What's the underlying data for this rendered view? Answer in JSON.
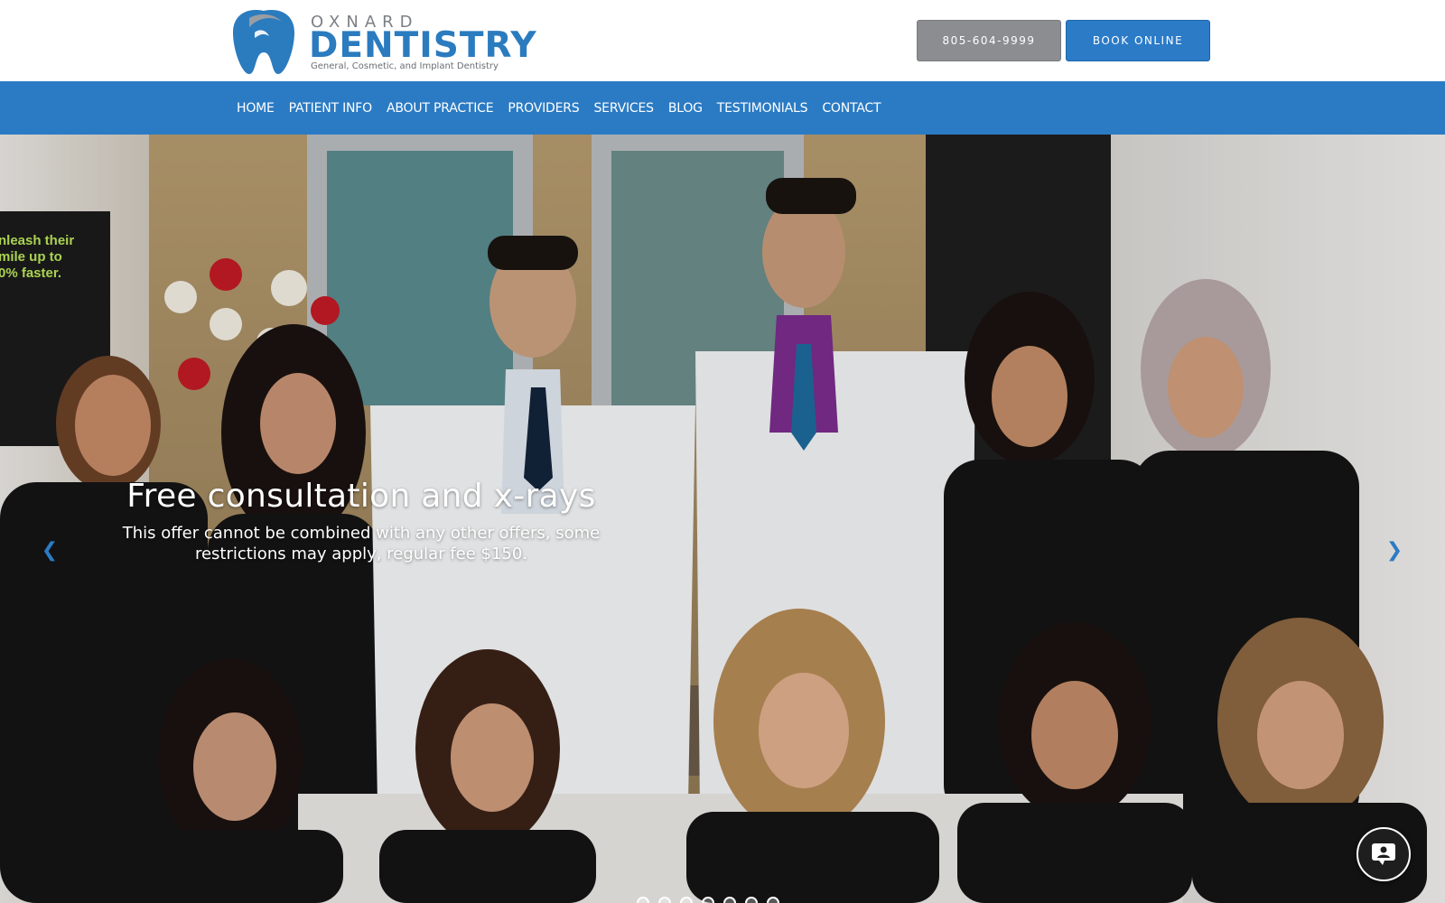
{
  "header": {
    "logo": {
      "top_text": "OXNARD",
      "main_text": "DENTISTRY",
      "tagline": "General, Cosmetic, and Implant Dentistry",
      "icon": "tooth-logo"
    },
    "phone_button": "805-604-9999",
    "book_button": "BOOK ONLINE"
  },
  "nav": {
    "items": [
      {
        "label": "HOME"
      },
      {
        "label": "PATIENT INFO"
      },
      {
        "label": "ABOUT PRACTICE"
      },
      {
        "label": "PROVIDERS"
      },
      {
        "label": "SERVICES"
      },
      {
        "label": "BLOG"
      },
      {
        "label": "TESTIMONIALS"
      },
      {
        "label": "CONTACT"
      }
    ]
  },
  "hero": {
    "title": "Free consultation and x-rays",
    "subtitle": "This offer cannot be combined with any other offers, some restrictions may apply, regular fee $150.",
    "poster_text": "nleash their\nmile up to\n0% faster.",
    "prev_icon": "chevron-left-icon",
    "next_icon": "chevron-right-icon",
    "slide_count": 7,
    "chat_icon": "chat-icon"
  },
  "colors": {
    "brand_blue": "#2b7bc4",
    "phone_grey": "#8c8d90",
    "logo_grey": "#7c7f84"
  }
}
